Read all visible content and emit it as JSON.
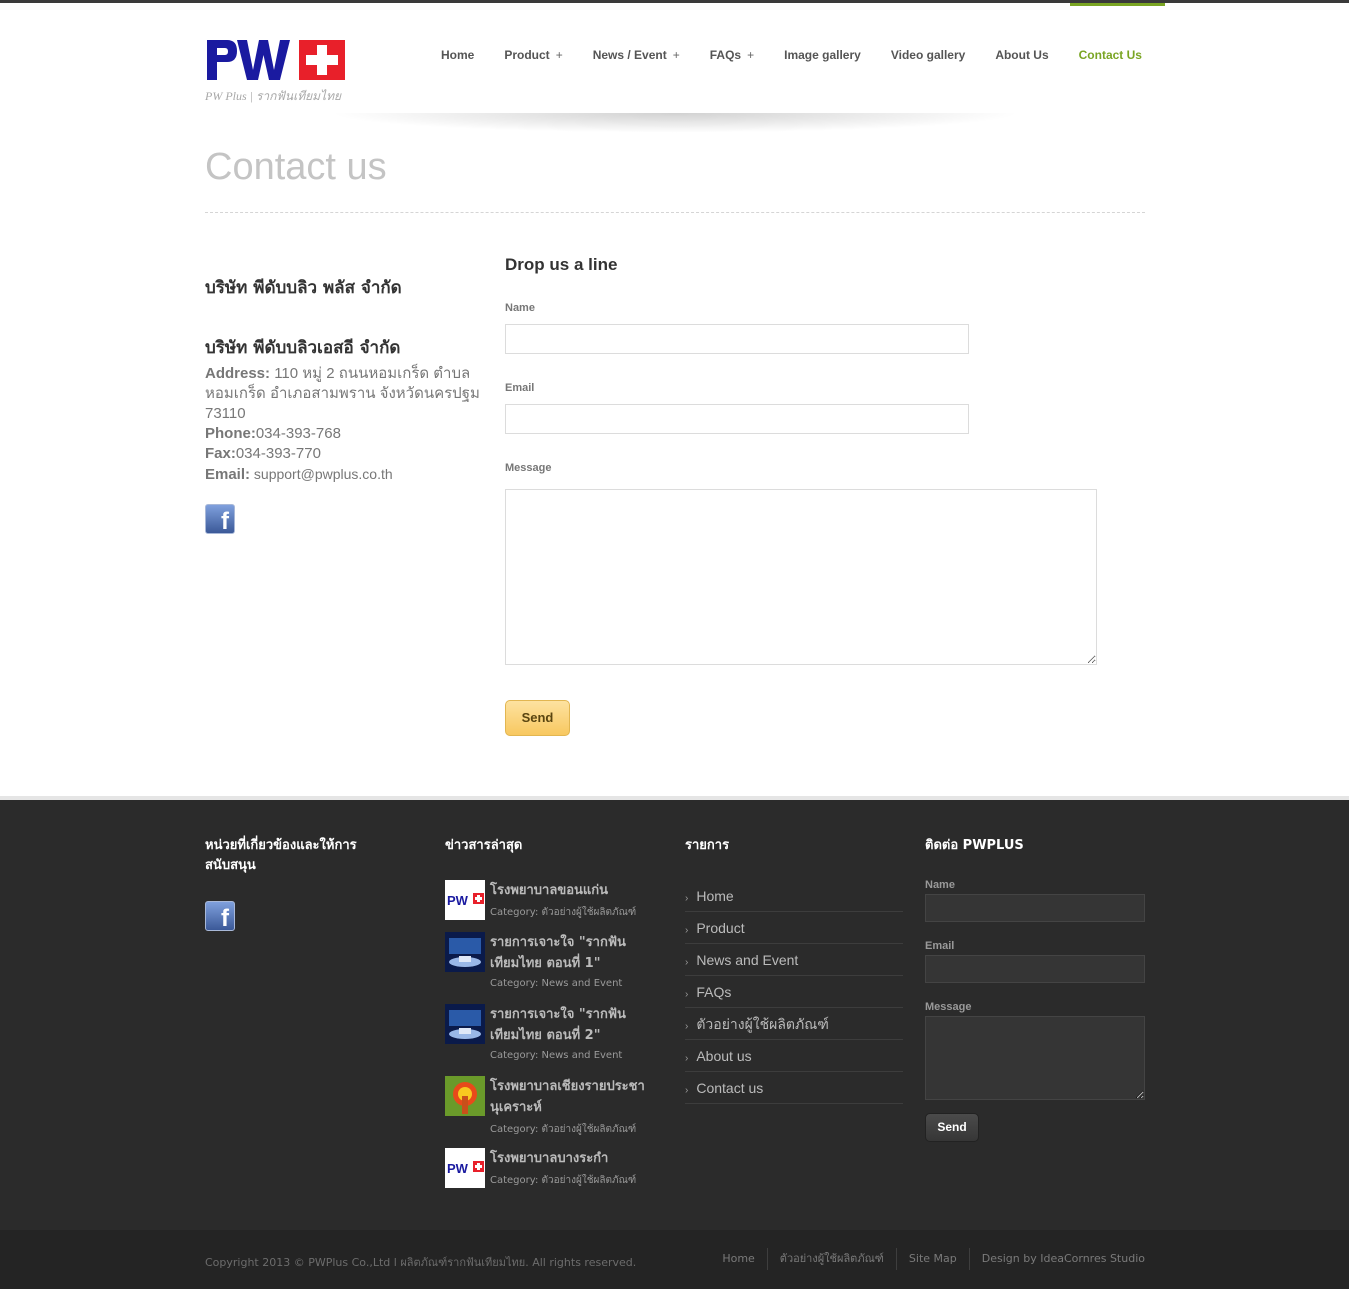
{
  "header": {
    "logo_tagline": "PW Plus | รากฟันเทียมไทย",
    "nav": [
      {
        "label": "Home",
        "has_submenu": false
      },
      {
        "label": "Product",
        "has_submenu": true
      },
      {
        "label": "News / Event",
        "has_submenu": true
      },
      {
        "label": "FAQs",
        "has_submenu": true
      },
      {
        "label": "Image gallery",
        "has_submenu": false
      },
      {
        "label": "Video gallery",
        "has_submenu": false
      },
      {
        "label": "About Us",
        "has_submenu": false
      },
      {
        "label": "Contact Us",
        "has_submenu": false,
        "active": true
      }
    ],
    "plus_glyph": "+"
  },
  "page": {
    "title": "Contact us"
  },
  "contact": {
    "company1": "บริษัท พีดับบลิว พลัส จำกัด",
    "company2": "บริษัท พีดับบลิวเอสอี จำกัด",
    "address_label": "Address:",
    "address_value": " 110 หมู่ 2 ถนนหอมเกร็ด ตำบลหอมเกร็ด อำเภอสามพราน จังหวัดนครปฐม 73110",
    "phone_label": "Phone:",
    "phone_value": "034-393-768",
    "fax_label": "Fax:",
    "fax_value": "034-393-770",
    "email_label": "Email:",
    "email_value": " support@pwplus.co.th"
  },
  "form": {
    "title": "Drop us a line",
    "name_label": "Name",
    "name_value": "",
    "email_label": "Email",
    "email_value": "",
    "message_label": "Message",
    "message_value": "",
    "send_label": "Send"
  },
  "footer": {
    "col1_title": "หน่วยที่เกี่ยวข้องและให้การสนับสนุน",
    "col2_title": "ข่าวสารล่าสุด",
    "col3_title": "รายการ",
    "col4_title": "ติดต่อ PWPLUS",
    "news": [
      {
        "title": "โรงพยาบาลขอนแก่น",
        "category": "Category: ตัวอย่างผู้ใช้ผลิตภัณฑ์",
        "thumb": "pw-logo"
      },
      {
        "title": "รายการเจาะใจ \"รากฟันเทียมไทย ตอนที่ 1\"",
        "category": "Category: News and Event",
        "thumb": "tv-studio"
      },
      {
        "title": "รายการเจาะใจ \"รากฟันเทียมไทย ตอนที่ 2\"",
        "category": "Category: News and Event",
        "thumb": "tv-studio"
      },
      {
        "title": "โรงพยาบาลเชียงรายประชานุเคราะห์",
        "category": "Category: ตัวอย่างผู้ใช้ผลิตภัณฑ์",
        "thumb": "hospital-emblem"
      },
      {
        "title": "โรงพยาบาลบางระกำ",
        "category": "Category: ตัวอย่างผู้ใช้ผลิตภัณฑ์",
        "thumb": "pw-logo"
      }
    ],
    "menu": [
      "Home",
      "Product",
      "News and Event",
      "FAQs",
      "ตัวอย่างผู้ใช้ผลิตภัณฑ์",
      "About us",
      "Contact us"
    ],
    "chevron_glyph": "›",
    "form": {
      "name_label": "Name",
      "email_label": "Email",
      "message_label": "Message",
      "send_label": "Send"
    }
  },
  "bottom": {
    "copyright": "Copyright 2013 © PWPlus Co.,Ltd l ผลิตภัณฑ์รากฟันเทียมไทย. All rights reserved.",
    "links": [
      "Home",
      "ตัวอย่างผู้ใช้ผลิตภัณฑ์",
      "Site Map",
      "Design by IdeaCornres Studio"
    ]
  },
  "colors": {
    "accent_green": "#7aa523",
    "send_button": "#f8c860",
    "footer_bg": "#2b2b2b",
    "logo_blue": "#1a1aa0",
    "logo_red": "#e8202a"
  }
}
